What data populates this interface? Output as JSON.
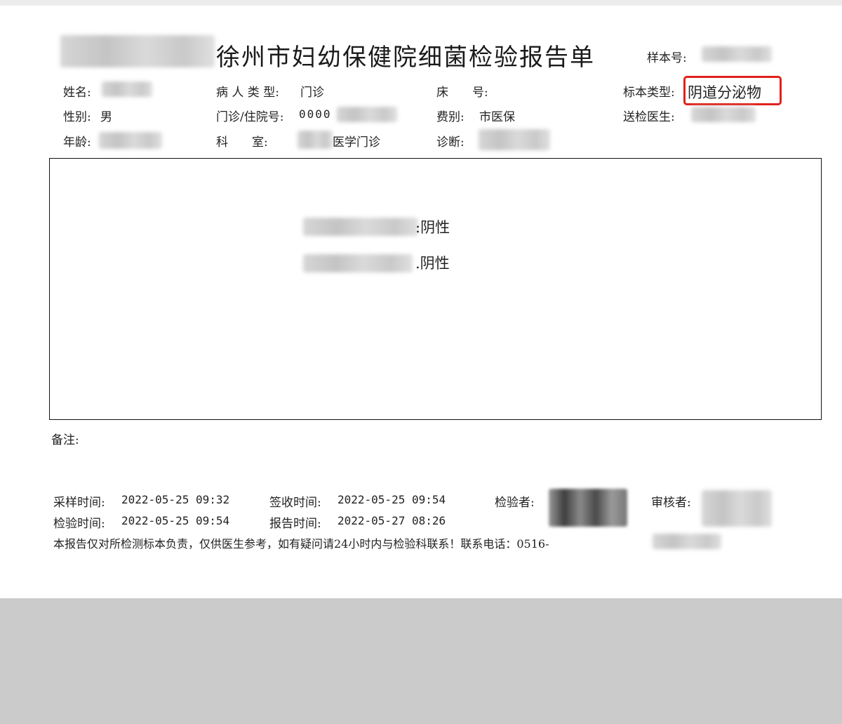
{
  "report": {
    "title": "徐州市妇幼保健院细菌检验报告单",
    "sample_no_label": "样本号:"
  },
  "patient": {
    "name_label": "姓名:",
    "patient_type_label": "病 人 类 型:",
    "patient_type_value": "门诊",
    "bed_label": "床　　号:",
    "specimen_type_label": "标本类型:",
    "specimen_type_value": "阴道分泌物",
    "sex_label": "性别:",
    "sex_value": "男",
    "id_no_label": "门诊/住院号:",
    "id_no_value": "0000",
    "fee_label": "费别:",
    "fee_value": "市医保",
    "doctor_label": "送检医生:",
    "age_label": "年龄:",
    "dept_label": "科　　室:",
    "dept_value": "医学门诊",
    "diagnosis_label": "诊断:"
  },
  "results": [
    {
      "value": ":阴性"
    },
    {
      "value": ".阴性"
    }
  ],
  "remarks": {
    "label": "备注:"
  },
  "footer": {
    "sampling_time_label": "采样时间:",
    "sampling_time": "2022-05-25 09:32",
    "receive_time_label": "签收时间:",
    "receive_time": "2022-05-25 09:54",
    "tester_label": "检验者:",
    "reviewer_label": "审核者:",
    "test_time_label": "检验时间:",
    "test_time": "2022-05-25 09:54",
    "report_time_label": "报告时间:",
    "report_time": "2022-05-27 08:26",
    "disclaimer": "本报告仅对所检测标本负责，仅供医生参考，如有疑问请24小时内与检验科联系！联系电话：0516-"
  },
  "colors": {
    "highlight": "#e0211b",
    "background_gray": "#cbcbcb"
  }
}
